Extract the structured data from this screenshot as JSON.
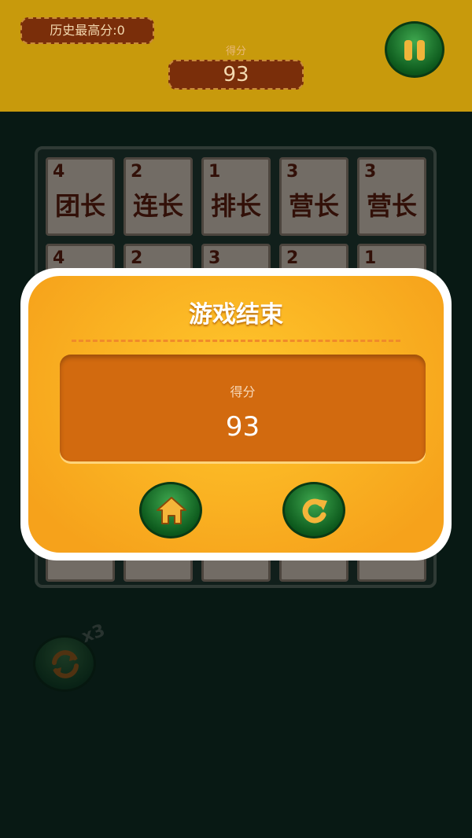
{
  "header": {
    "best_score_label": "历史最高分:0",
    "score_label": "得分",
    "score_value": "93"
  },
  "board": {
    "row1": [
      {
        "level": "4",
        "name": "团长"
      },
      {
        "level": "2",
        "name": "连长"
      },
      {
        "level": "1",
        "name": "排长"
      },
      {
        "level": "3",
        "name": "营长"
      },
      {
        "level": "3",
        "name": "营长"
      }
    ],
    "row2": [
      {
        "level": "4",
        "name": ""
      },
      {
        "level": "2",
        "name": ""
      },
      {
        "level": "3",
        "name": ""
      },
      {
        "level": "2",
        "name": ""
      },
      {
        "level": "1",
        "name": ""
      }
    ]
  },
  "dialog": {
    "title": "游戏结束",
    "score_label": "得分",
    "score_value": "93"
  },
  "powerup": {
    "count": "x3"
  },
  "colors": {
    "header_bg": "#c89a0c",
    "page_bg": "#0f2e25",
    "dialog_orange": "#f6a21b",
    "panel_bg": "#d26a0f",
    "button_green": "#0d5a1d",
    "icon_gold": "#f0b43a",
    "tile_text": "#5b1e10"
  },
  "icons": {
    "pause": "pause-icon",
    "home": "home-icon",
    "restart": "restart-icon",
    "shuffle": "shuffle-icon"
  }
}
